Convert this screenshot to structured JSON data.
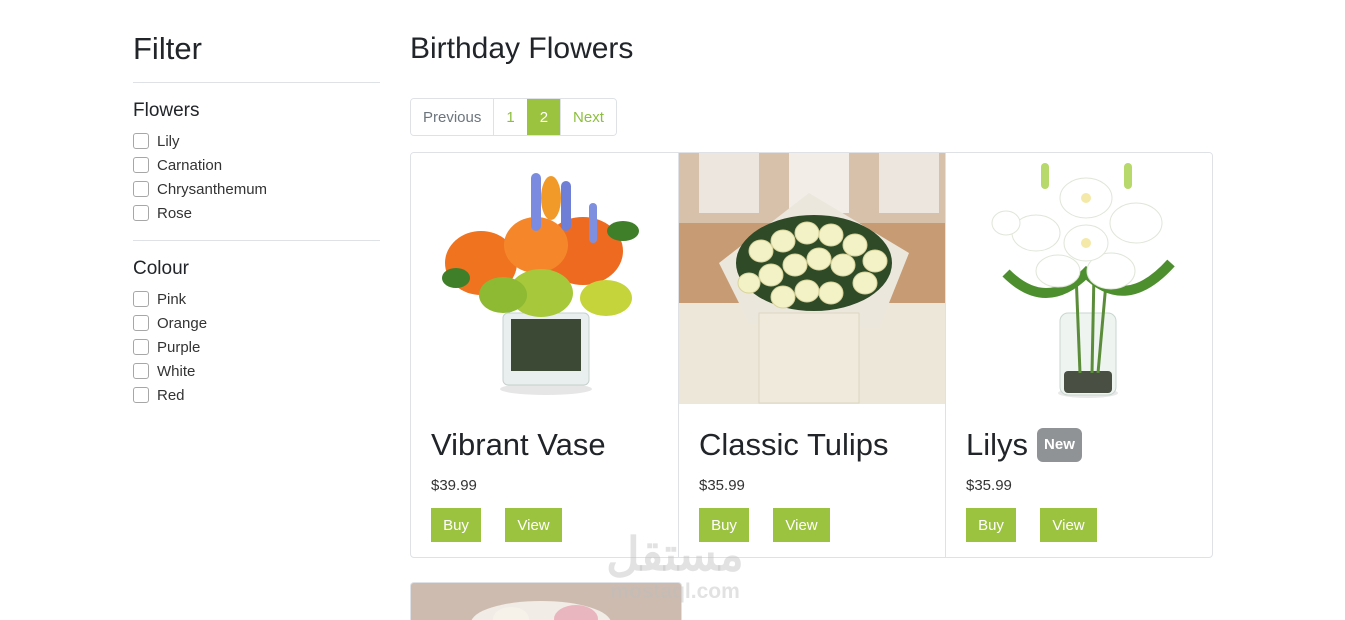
{
  "sidebar": {
    "title": "Filter",
    "flowers": {
      "heading": "Flowers",
      "options": [
        "Lily",
        "Carnation",
        "Chrysanthemum",
        "Rose"
      ]
    },
    "colour": {
      "heading": "Colour",
      "options": [
        "Pink",
        "Orange",
        "Purple",
        "White",
        "Red"
      ]
    }
  },
  "main": {
    "title": "Birthday Flowers",
    "pagination": {
      "previous": "Previous",
      "pages": [
        "1",
        "2"
      ],
      "active_page": "2",
      "next": "Next"
    },
    "products": [
      {
        "name": "Vibrant Vase",
        "price": "$39.99",
        "badge": "",
        "buy": "Buy",
        "view": "View"
      },
      {
        "name": "Classic Tulips",
        "price": "$35.99",
        "badge": "",
        "buy": "Buy",
        "view": "View"
      },
      {
        "name": "Lilys",
        "price": "$35.99",
        "badge": "New",
        "buy": "Buy",
        "view": "View"
      }
    ]
  },
  "watermark": {
    "arabic": "مستقل",
    "latin": "mostaql.com"
  },
  "colors": {
    "accent": "#9cc33f",
    "badge": "#8f9396",
    "border": "#dee2e6"
  }
}
